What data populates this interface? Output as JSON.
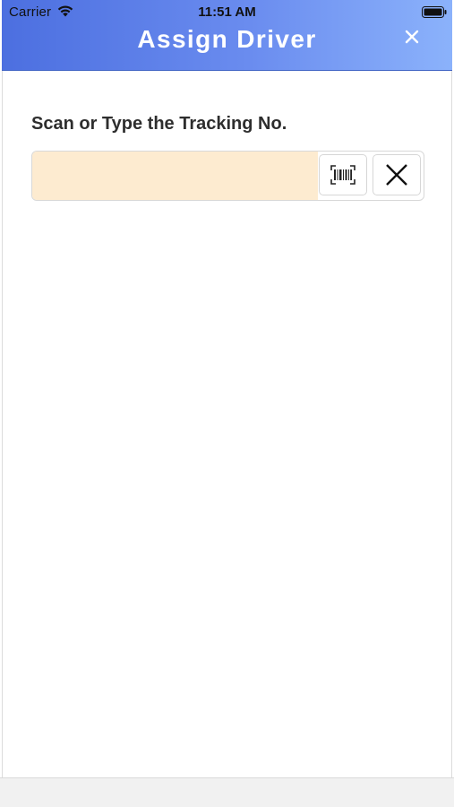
{
  "status_bar": {
    "carrier": "Carrier",
    "time": "11:51 AM",
    "wifi_icon": "wifi-icon",
    "battery_icon": "battery-icon"
  },
  "header": {
    "title": "Assign Driver",
    "close_icon": "close-icon",
    "gradient_start": "#4c6fe0",
    "gradient_end": "#8bb2fb"
  },
  "form": {
    "label": "Scan or Type the Tracking No.",
    "tracking_input": {
      "value": "",
      "placeholder": "",
      "background": "#fdebd0"
    },
    "scan_button_icon": "barcode-scan-icon",
    "clear_button_icon": "clear-x-icon"
  }
}
